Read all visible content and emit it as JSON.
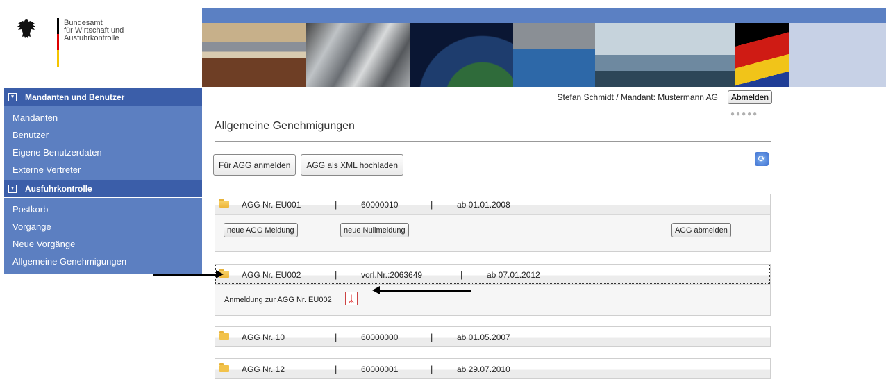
{
  "logo": {
    "lines": [
      "Bundesamt",
      "für Wirtschaft und",
      "Ausfuhrkontrolle"
    ]
  },
  "sidebar": {
    "sections": [
      {
        "title": "Mandanten und Benutzer",
        "items": [
          "Mandanten",
          "Benutzer",
          "Eigene Benutzerdaten",
          "Externe Vertreter"
        ]
      },
      {
        "title": "Ausfuhrkontrolle",
        "items": [
          "Postkorb",
          "Vorgänge",
          "Neue Vorgänge",
          "Allgemeine Genehmigungen"
        ]
      }
    ]
  },
  "header": {
    "user": "Stefan Schmidt / Mandant: Mustermann AG",
    "logout": "Abmelden",
    "dots": "●●●●●"
  },
  "main": {
    "title": "Allgemeine Genehmigungen",
    "buttons": [
      "Für AGG anmelden",
      "AGG als XML hochladen"
    ],
    "refresh_icon": "refresh-icon"
  },
  "agg": [
    {
      "nr": "AGG Nr. EU001",
      "num": "60000010",
      "date": "ab 01.01.2008",
      "sep": "|",
      "actions": [
        "neue AGG Meldung",
        "neue Nullmeldung",
        "AGG abmelden"
      ]
    },
    {
      "nr": "AGG Nr. EU002",
      "num": "vorl.Nr.:2063649",
      "date": "ab 07.01.2012",
      "sep": "|",
      "note": "Anmeldung zur AGG Nr. EU002"
    },
    {
      "nr": "AGG Nr. 10",
      "num": "60000000",
      "date": "ab 01.05.2007",
      "sep": "|"
    },
    {
      "nr": "AGG Nr. 12",
      "num": "60000001",
      "date": "ab 29.07.2010",
      "sep": "|"
    }
  ],
  "colors": {
    "sidebar_dark": "#3b5ea9",
    "sidebar": "#5c7fc1",
    "banner": "#5b80c3"
  }
}
